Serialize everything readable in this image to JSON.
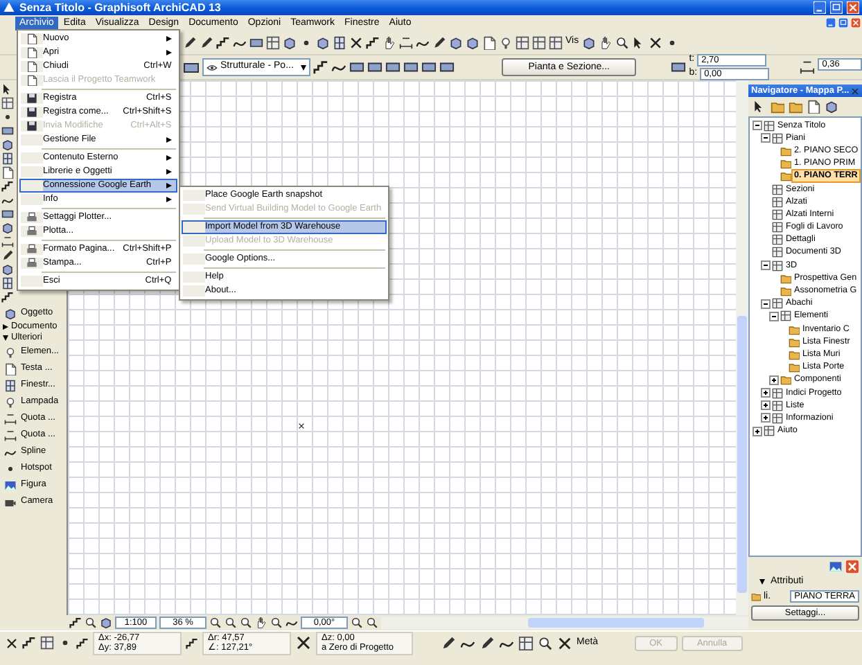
{
  "window": {
    "title": "Senza Titolo - Graphisoft ArchiCAD 13"
  },
  "menu_bar": [
    {
      "label": "Archivio",
      "selected": true
    },
    {
      "label": "Edita",
      "selected": false
    },
    {
      "label": "Visualizza",
      "selected": false
    },
    {
      "label": "Design",
      "selected": false
    },
    {
      "label": "Documento",
      "selected": false
    },
    {
      "label": "Opzioni",
      "selected": false
    },
    {
      "label": "Teamwork",
      "selected": false
    },
    {
      "label": "Finestre",
      "selected": false
    },
    {
      "label": "Aiuto",
      "selected": false
    }
  ],
  "toolbar": {
    "view_mode": "Vis",
    "layer_combo": "Strutturale - Po...",
    "view_button": "Pianta e Sezione...",
    "height_fields": [
      {
        "label": "t:",
        "value": "2,70"
      },
      {
        "label": "b:",
        "value": "0,00"
      }
    ],
    "thickness_field": "0,36"
  },
  "archivio_menu": [
    {
      "kind": "item",
      "label": "Nuovo",
      "icon": true,
      "submenu": true,
      "disabled": false,
      "selected": false
    },
    {
      "kind": "item",
      "label": "Apri",
      "icon": true,
      "submenu": true,
      "disabled": false,
      "selected": false
    },
    {
      "kind": "item",
      "label": "Chiudi",
      "shortcut": "Ctrl+W",
      "icon": true,
      "submenu": false,
      "disabled": false,
      "selected": false
    },
    {
      "kind": "item",
      "label": "Lascia il Progetto Teamwork",
      "icon": true,
      "submenu": false,
      "disabled": true,
      "selected": false
    },
    {
      "kind": "separator"
    },
    {
      "kind": "item",
      "label": "Registra",
      "shortcut": "Ctrl+S",
      "icon": true,
      "submenu": false,
      "disabled": false,
      "selected": false
    },
    {
      "kind": "item",
      "label": "Registra come...",
      "shortcut": "Ctrl+Shift+S",
      "icon": true,
      "submenu": false,
      "disabled": false,
      "selected": false
    },
    {
      "kind": "item",
      "label": "Invia Modifiche",
      "shortcut": "Ctrl+Alt+S",
      "icon": true,
      "submenu": false,
      "disabled": true,
      "selected": false
    },
    {
      "kind": "item",
      "label": "Gestione File",
      "icon": false,
      "submenu": true,
      "disabled": false,
      "selected": false
    },
    {
      "kind": "separator"
    },
    {
      "kind": "item",
      "label": "Contenuto Esterno",
      "icon": false,
      "submenu": true,
      "disabled": false,
      "selected": false
    },
    {
      "kind": "item",
      "label": "Librerie e Oggetti",
      "icon": false,
      "submenu": true,
      "disabled": false,
      "selected": false
    },
    {
      "kind": "item",
      "label": "Connessione Google Earth",
      "icon": false,
      "submenu": true,
      "disabled": false,
      "selected": true
    },
    {
      "kind": "item",
      "label": "Info",
      "icon": false,
      "submenu": true,
      "disabled": false,
      "selected": false
    },
    {
      "kind": "separator"
    },
    {
      "kind": "item",
      "label": "Settaggi Plotter...",
      "icon": true,
      "submenu": false,
      "disabled": false,
      "selected": false
    },
    {
      "kind": "item",
      "label": "Plotta...",
      "icon": true,
      "submenu": false,
      "disabled": false,
      "selected": false
    },
    {
      "kind": "separator"
    },
    {
      "kind": "item",
      "label": "Formato Pagina...",
      "shortcut": "Ctrl+Shift+P",
      "icon": true,
      "submenu": false,
      "disabled": false,
      "selected": false
    },
    {
      "kind": "item",
      "label": "Stampa...",
      "shortcut": "Ctrl+P",
      "icon": true,
      "submenu": false,
      "disabled": false,
      "selected": false
    },
    {
      "kind": "separator"
    },
    {
      "kind": "item",
      "label": "Esci",
      "shortcut": "Ctrl+Q",
      "icon": false,
      "submenu": false,
      "disabled": false,
      "selected": false
    }
  ],
  "google_earth_submenu": [
    {
      "kind": "item",
      "label": "Place Google Earth snapshot",
      "disabled": false,
      "selected": false
    },
    {
      "kind": "item",
      "label": "Send Virtual Building Model to Google Earth",
      "disabled": true,
      "selected": false
    },
    {
      "kind": "separator"
    },
    {
      "kind": "item",
      "label": "Import Model from 3D Warehouse",
      "disabled": false,
      "selected": true
    },
    {
      "kind": "item",
      "label": "Upload Model to 3D Warehouse",
      "disabled": true,
      "selected": false
    },
    {
      "kind": "separator"
    },
    {
      "kind": "item",
      "label": "Google Options...",
      "disabled": false,
      "selected": false
    },
    {
      "kind": "separator"
    },
    {
      "kind": "item",
      "label": "Help",
      "disabled": false,
      "selected": false
    },
    {
      "kind": "item",
      "label": "About...",
      "disabled": false,
      "selected": false
    }
  ],
  "toolbox": [
    {
      "kind": "tool",
      "label": "Oggetto"
    },
    {
      "kind": "group",
      "label": "Documento",
      "expanded": false
    },
    {
      "kind": "group",
      "label": "Ulteriori",
      "expanded": true
    },
    {
      "kind": "tool",
      "label": "Elemen..."
    },
    {
      "kind": "tool",
      "label": "Testa ..."
    },
    {
      "kind": "tool",
      "label": "Finestr..."
    },
    {
      "kind": "tool",
      "label": "Lampada"
    },
    {
      "kind": "tool",
      "label": "Quota ..."
    },
    {
      "kind": "tool",
      "label": "Quota ..."
    },
    {
      "kind": "tool",
      "label": "Spline"
    },
    {
      "kind": "tool",
      "label": "Hotspot"
    },
    {
      "kind": "tool",
      "label": "Figura"
    },
    {
      "kind": "tool",
      "label": "Camera"
    }
  ],
  "view_bar": {
    "scale": "1:100",
    "zoom": "36 %",
    "angle": "0,00°"
  },
  "navigator": {
    "title": "Navigatore - Mappa P...",
    "tree": [
      {
        "label": "Senza Titolo",
        "expanded": true,
        "selected": false,
        "children": [
          {
            "label": "Piani",
            "expanded": true,
            "selected": false,
            "children": [
              {
                "label": "2. PIANO SECO",
                "selected": false
              },
              {
                "label": "1. PIANO PRIM",
                "selected": false
              },
              {
                "label": "0. PIANO TERR",
                "selected": true
              }
            ]
          },
          {
            "label": "Sezioni",
            "selected": false
          },
          {
            "label": "Alzati",
            "selected": false
          },
          {
            "label": "Alzati Interni",
            "selected": false
          },
          {
            "label": "Fogli di Lavoro",
            "selected": false
          },
          {
            "label": "Dettagli",
            "selected": false
          },
          {
            "label": "Documenti 3D",
            "selected": false
          },
          {
            "label": "3D",
            "expanded": true,
            "selected": false,
            "children": [
              {
                "label": "Prospettiva Gen",
                "selected": false
              },
              {
                "label": "Assonometria G",
                "selected": false
              }
            ]
          },
          {
            "label": "Abachi",
            "expanded": true,
            "selected": false,
            "children": [
              {
                "label": "Elementi",
                "expanded": true,
                "selected": false,
                "children": [
                  {
                    "label": "Inventario C",
                    "selected": false
                  },
                  {
                    "label": "Lista Finestr",
                    "selected": false
                  },
                  {
                    "label": "Lista Muri",
                    "selected": false
                  },
                  {
                    "label": "Lista Porte",
                    "selected": false
                  }
                ]
              },
              {
                "label": "Componenti",
                "expanded": false,
                "selected": false
              }
            ]
          },
          {
            "label": "Indici Progetto",
            "expanded": false,
            "selected": false
          },
          {
            "label": "Liste",
            "expanded": false,
            "selected": false
          },
          {
            "label": "Informazioni",
            "expanded": false,
            "selected": false
          }
        ]
      },
      {
        "label": "Aiuto",
        "expanded": false,
        "selected": false
      }
    ]
  },
  "attributes": {
    "header": "Attributi",
    "expanded": true,
    "layer_label": "li.",
    "layer": "PIANO TERRA",
    "settings_button": "Settaggi..."
  },
  "info_bar": {
    "coordinates": [
      {
        "label": "Δx:",
        "value": "-26,77"
      },
      {
        "label": "Δy:",
        "value": "37,89"
      },
      {
        "label": "Δr:",
        "value": "47,57"
      },
      {
        "label": "∠:",
        "value": "127,21°"
      },
      {
        "label": "Δz:",
        "value": "0,00"
      }
    ],
    "reference": "a Zero di Progetto",
    "snap": "Metà",
    "ok_button": {
      "label": "OK",
      "disabled": true
    },
    "cancel_button": {
      "label": "Annulla",
      "disabled": true
    }
  }
}
